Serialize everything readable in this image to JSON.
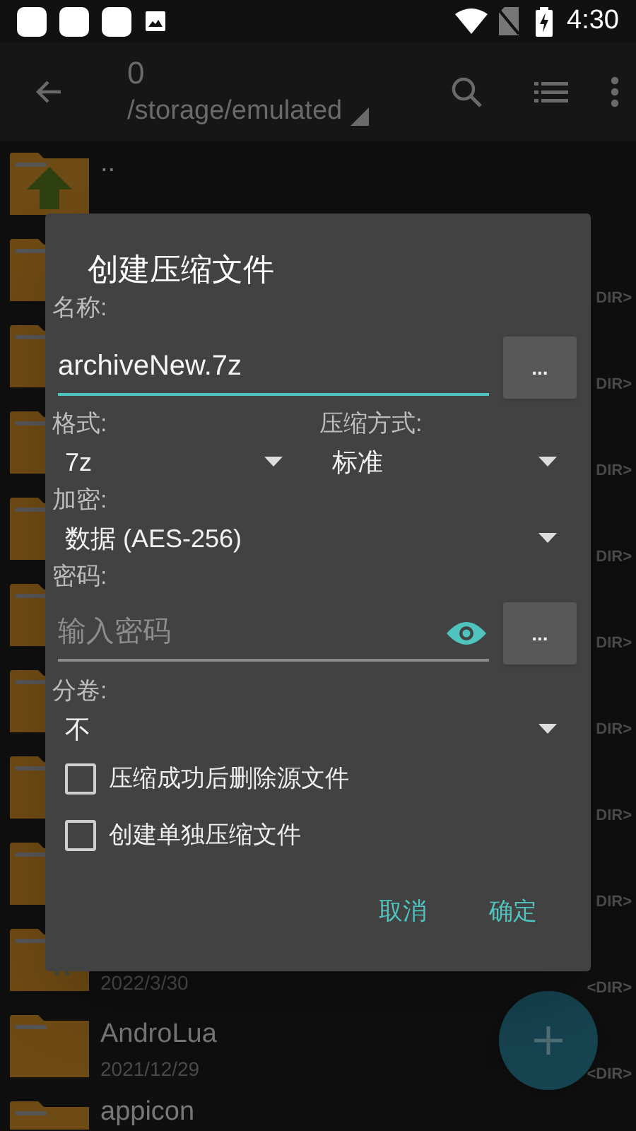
{
  "status_bar": {
    "time": "4:30"
  },
  "toolbar": {
    "title": "0",
    "path": "/storage/emulated"
  },
  "files": [
    {
      "kind": "parent",
      "name": ".."
    },
    {
      "kind": "folder",
      "tag": "DIR>"
    },
    {
      "kind": "folder",
      "tag": "DIR>"
    },
    {
      "kind": "folder",
      "tag": "DIR>"
    },
    {
      "kind": "folder",
      "tag": "DIR>"
    },
    {
      "kind": "folder",
      "tag": "DIR>"
    },
    {
      "kind": "folder",
      "tag": "DIR>"
    },
    {
      "kind": "folder",
      "tag": "DIR>"
    },
    {
      "kind": "folder",
      "tag": "DIR>"
    },
    {
      "kind": "android",
      "date": "2022/3/30",
      "tag": "<DIR>"
    },
    {
      "kind": "folder",
      "name": "AndroLua",
      "date": "2021/12/29",
      "tag": "<DIR>"
    },
    {
      "kind": "folder",
      "name": "appicon"
    }
  ],
  "dialog": {
    "title": "创建压缩文件",
    "name_label": "名称:",
    "name_field": {
      "value": "archiveNew.7z",
      "focused": true
    },
    "name_browse": "...",
    "format": {
      "label": "格式:",
      "value": "7z"
    },
    "method": {
      "label": "压缩方式:",
      "value": "标准"
    },
    "encryption": {
      "label": "加密:",
      "value": "数据 (AES-256)"
    },
    "password": {
      "label": "密码:",
      "placeholder": "输入密码",
      "focused": false
    },
    "password_browse": "...",
    "split": {
      "label": "分卷:",
      "value": "不"
    },
    "options": [
      {
        "label": "压缩成功后删除源文件",
        "checked": false
      },
      {
        "label": "创建单独压缩文件",
        "checked": false
      }
    ],
    "buttons": [
      "取消",
      "确定"
    ]
  }
}
